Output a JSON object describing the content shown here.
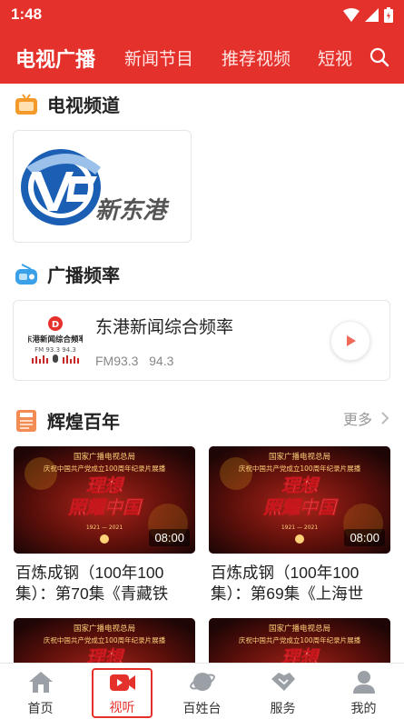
{
  "status_bar": {
    "time": "1:48"
  },
  "top_nav": {
    "tabs": [
      {
        "label": "电视广播",
        "active": true
      },
      {
        "label": "新闻节目",
        "active": false
      },
      {
        "label": "推荐视频",
        "active": false
      },
      {
        "label": "短视",
        "active": false
      }
    ]
  },
  "tv_section": {
    "title": "电视频道",
    "channel_logo_text": "新东港"
  },
  "radio_section": {
    "title": "广播频率",
    "channel": {
      "name": "东港新闻综合频率",
      "freq": "FM93.3   94.3",
      "logo_text": "东港新闻综合频率",
      "logo_freq": "FM 93.3  94.3"
    }
  },
  "centennial_section": {
    "title": "辉煌百年",
    "more_label": "更多",
    "poster_top_line": "国家广播电视总局",
    "poster_sub_line": "庆祝中国共产党成立100周年纪录片展播",
    "poster_title_1": "理想",
    "poster_title_2": "照耀中国",
    "poster_years": "1921 — 2021",
    "videos": [
      {
        "duration": "08:00",
        "title": "百炼成钢（100年100集）：第70集《青藏铁"
      },
      {
        "duration": "08:00",
        "title": "百炼成钢（100年100集）：第69集《上海世"
      },
      {
        "duration": "",
        "title": ""
      },
      {
        "duration": "",
        "title": ""
      }
    ]
  },
  "bottom_nav": {
    "items": [
      {
        "label": "首页"
      },
      {
        "label": "视听"
      },
      {
        "label": "百姓台"
      },
      {
        "label": "服务"
      },
      {
        "label": "我的"
      }
    ]
  },
  "colors": {
    "brand_red": "#e5312c",
    "blue": "#1a5fb4"
  }
}
